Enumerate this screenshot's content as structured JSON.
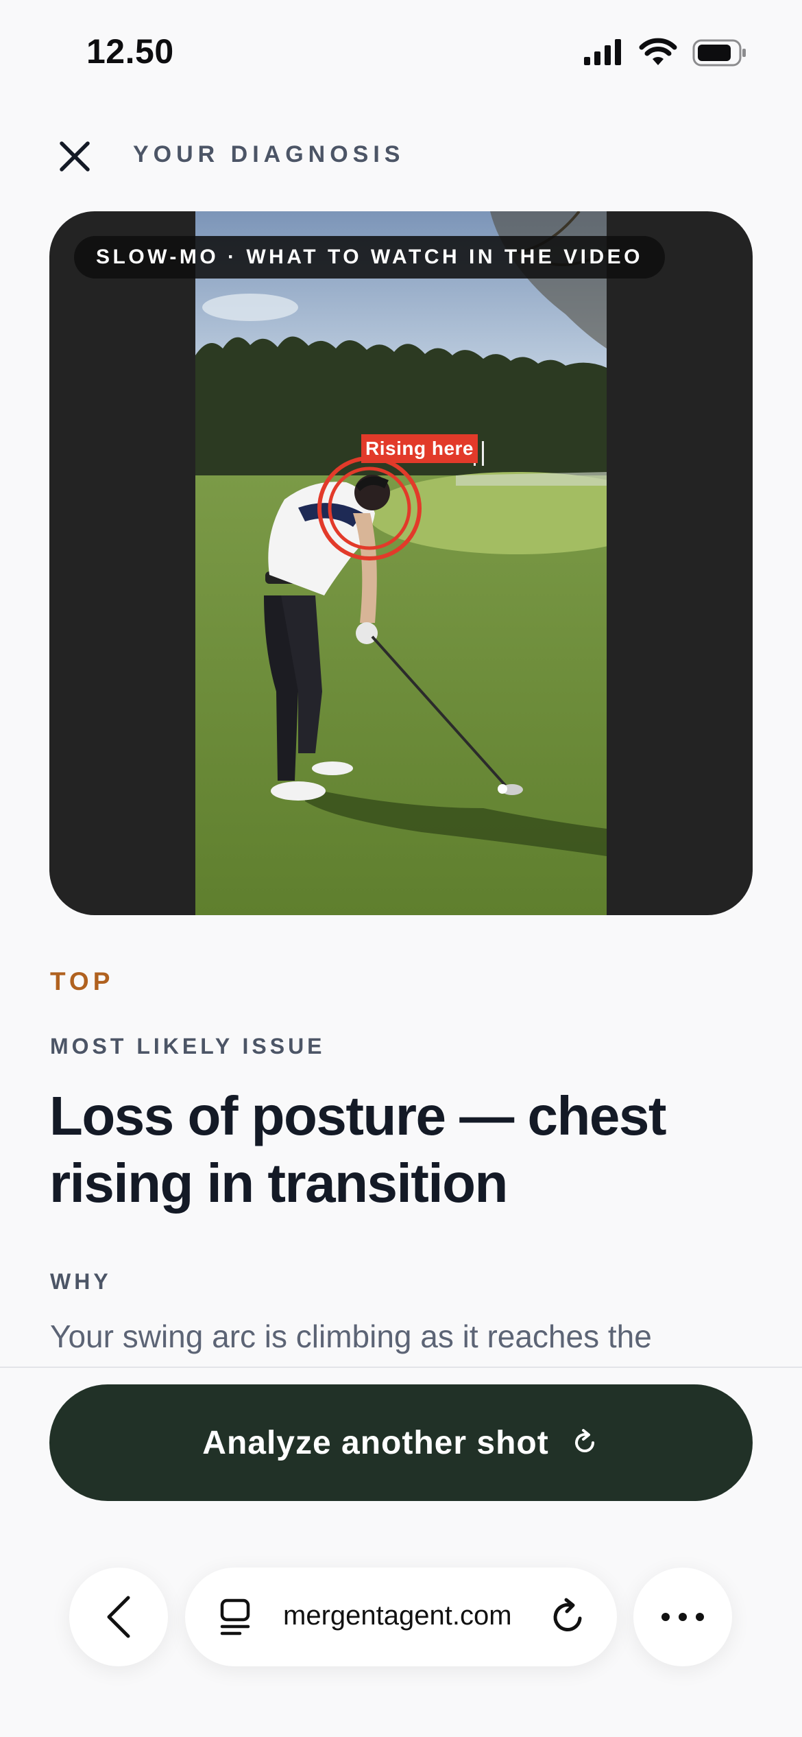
{
  "status_bar": {
    "time": "12.50",
    "icons": [
      "cellular-signal-icon",
      "wifi-icon",
      "battery-icon"
    ]
  },
  "header": {
    "close_icon": "close-icon",
    "title": "YOUR DIAGNOSIS"
  },
  "video": {
    "overlay_label": "SLOW-MO · WHAT TO WATCH IN THE VIDEO",
    "marker_label": "Rising here",
    "marker_color": "#e23a2a"
  },
  "diagnosis": {
    "severity": "TOP",
    "kicker": "MOST LIKELY ISSUE",
    "title": "Loss of posture — chest rising in transition",
    "why_label": "WHY",
    "why_text": "Your swing arc is climbing as it reaches the"
  },
  "actions": {
    "analyze_label": "Analyze another shot",
    "analyze_icon": "refresh-icon",
    "button_color": "#213127"
  },
  "browser": {
    "back_icon": "chevron-left-icon",
    "tabs_icon": "tabs-icon",
    "url": "mergentagent.com",
    "reload_icon": "reload-icon",
    "more_icon": "more-icon"
  },
  "colors": {
    "accent_orange": "#b0611f",
    "heading": "#141a26",
    "muted": "#4c5566"
  }
}
